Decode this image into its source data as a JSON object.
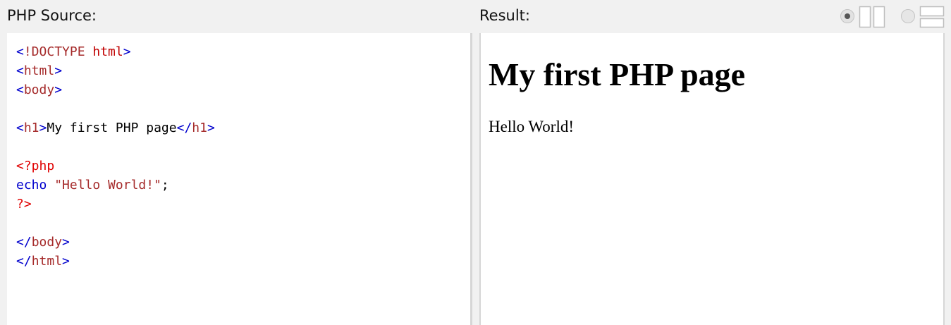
{
  "header": {
    "source_label": "PHP Source:",
    "result_label": "Result:"
  },
  "colors": {
    "page_background": "#f1f1f1",
    "panel_background": "#ffffff",
    "tag_bracket": "#0000cd",
    "tag_name": "#a52a2a",
    "doctype": "#c00000",
    "php_delimiter": "#e00000",
    "php_keyword": "#0000cd",
    "php_string": "#a52a2a",
    "plain_text": "#000000"
  },
  "source": {
    "lines": [
      [
        {
          "text": "<",
          "kind": "bracket"
        },
        {
          "text": "!DOCTYPE",
          "kind": "tagname"
        },
        {
          "text": " html",
          "kind": "doctype"
        },
        {
          "text": ">",
          "kind": "bracket"
        }
      ],
      [
        {
          "text": "<",
          "kind": "bracket"
        },
        {
          "text": "html",
          "kind": "tagname"
        },
        {
          "text": ">",
          "kind": "bracket"
        }
      ],
      [
        {
          "text": "<",
          "kind": "bracket"
        },
        {
          "text": "body",
          "kind": "tagname"
        },
        {
          "text": ">",
          "kind": "bracket"
        }
      ],
      [],
      [
        {
          "text": "<",
          "kind": "bracket"
        },
        {
          "text": "h1",
          "kind": "tagname"
        },
        {
          "text": ">",
          "kind": "bracket"
        },
        {
          "text": "My first PHP page",
          "kind": "plain"
        },
        {
          "text": "</",
          "kind": "bracket"
        },
        {
          "text": "h1",
          "kind": "tagname"
        },
        {
          "text": ">",
          "kind": "bracket"
        }
      ],
      [],
      [
        {
          "text": "<?php",
          "kind": "phpdelim"
        }
      ],
      [
        {
          "text": "echo",
          "kind": "keyword"
        },
        {
          "text": " ",
          "kind": "plain"
        },
        {
          "text": "\"Hello World!\"",
          "kind": "string"
        },
        {
          "text": ";",
          "kind": "plain"
        }
      ],
      [
        {
          "text": "?>",
          "kind": "phpdelim"
        }
      ],
      [],
      [
        {
          "text": "</",
          "kind": "bracket"
        },
        {
          "text": "body",
          "kind": "tagname"
        },
        {
          "text": ">",
          "kind": "bracket"
        }
      ],
      [
        {
          "text": "</",
          "kind": "bracket"
        },
        {
          "text": "html",
          "kind": "tagname"
        },
        {
          "text": ">",
          "kind": "bracket"
        }
      ]
    ]
  },
  "result": {
    "heading": "My first PHP page",
    "paragraph": "Hello World!"
  },
  "layout_toggles": [
    {
      "name": "side-by-side",
      "icon": "columns-layout-icon",
      "selected": true
    },
    {
      "name": "stacked",
      "icon": "rows-layout-icon",
      "selected": false
    }
  ]
}
